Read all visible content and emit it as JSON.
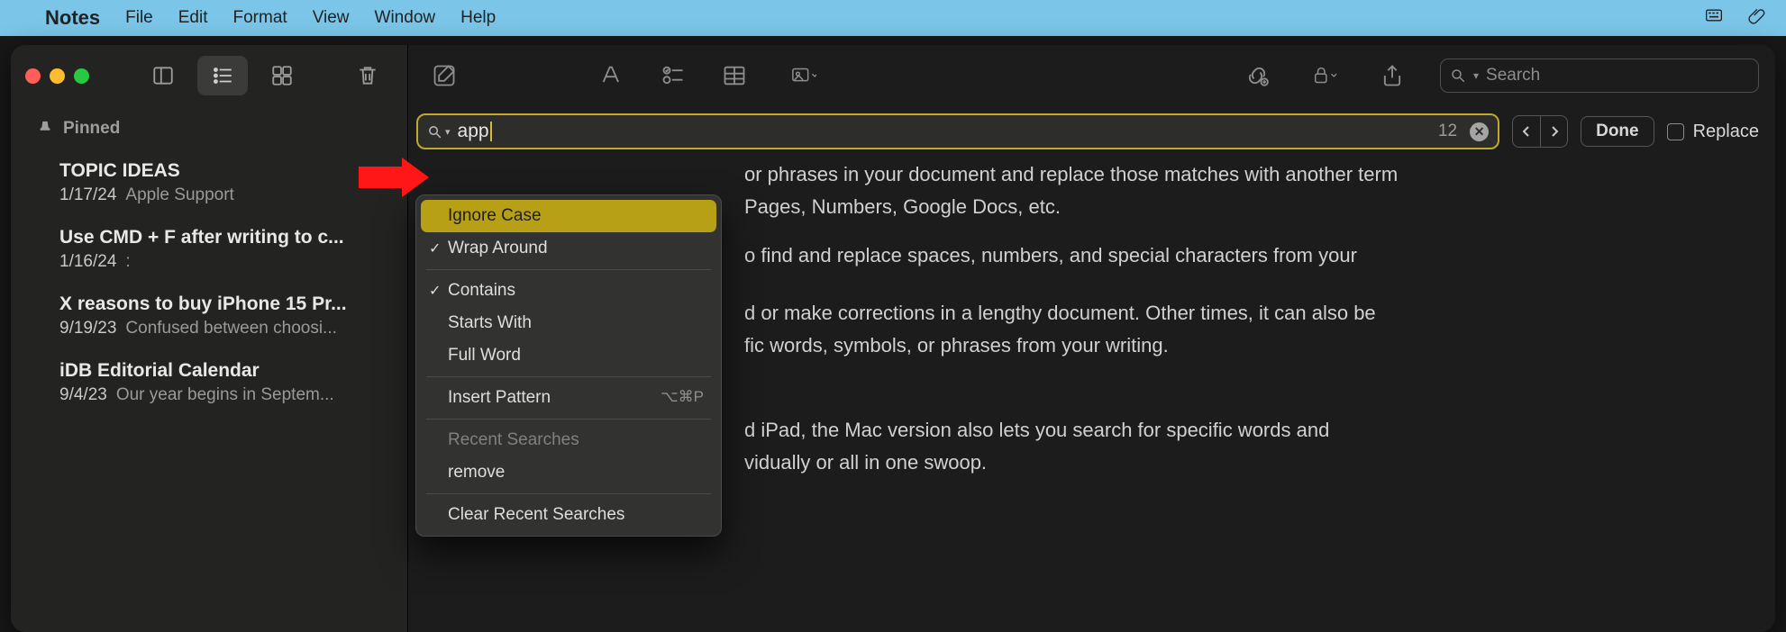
{
  "menubar": {
    "app": "Notes",
    "items": [
      "File",
      "Edit",
      "Format",
      "View",
      "Window",
      "Help"
    ]
  },
  "sidebar": {
    "pinned_label": "Pinned",
    "notes": [
      {
        "title": "TOPIC IDEAS",
        "date": "1/17/24",
        "preview": "Apple Support"
      },
      {
        "title": "Use CMD + F after writing to c...",
        "date": "1/16/24",
        "preview": ":"
      },
      {
        "title": "X reasons to buy iPhone 15 Pr...",
        "date": "9/19/23",
        "preview": "Confused between choosi..."
      },
      {
        "title": "iDB Editorial Calendar",
        "date": "9/4/23",
        "preview": "Our year begins in Septem..."
      }
    ]
  },
  "toolbar_search_placeholder": "Search",
  "find": {
    "value": "app",
    "count": "12",
    "done": "Done",
    "replace_label": "Replace",
    "dropdown": {
      "ignore_case": "Ignore Case",
      "wrap_around": "Wrap Around",
      "contains": "Contains",
      "starts_with": "Starts With",
      "full_word": "Full Word",
      "insert_pattern": "Insert Pattern",
      "insert_pattern_keys": "⌥⌘P",
      "recent_label": "Recent Searches",
      "recent_item": "remove",
      "clear": "Clear Recent Searches"
    }
  },
  "body": {
    "p1": "or phrases in your document and replace those matches with another term",
    "p1b": "Pages, Numbers, Google Docs, etc.",
    "p2": "o find and replace spaces, numbers, and special characters from your",
    "p3": "d or make corrections in a lengthy document. Other times, it can also be",
    "p3b": "fic words, symbols, or phrases from your writing.",
    "p4": "d iPad, the Mac version also lets you search for specific words and",
    "p4b": "vidually or all in one swoop."
  }
}
